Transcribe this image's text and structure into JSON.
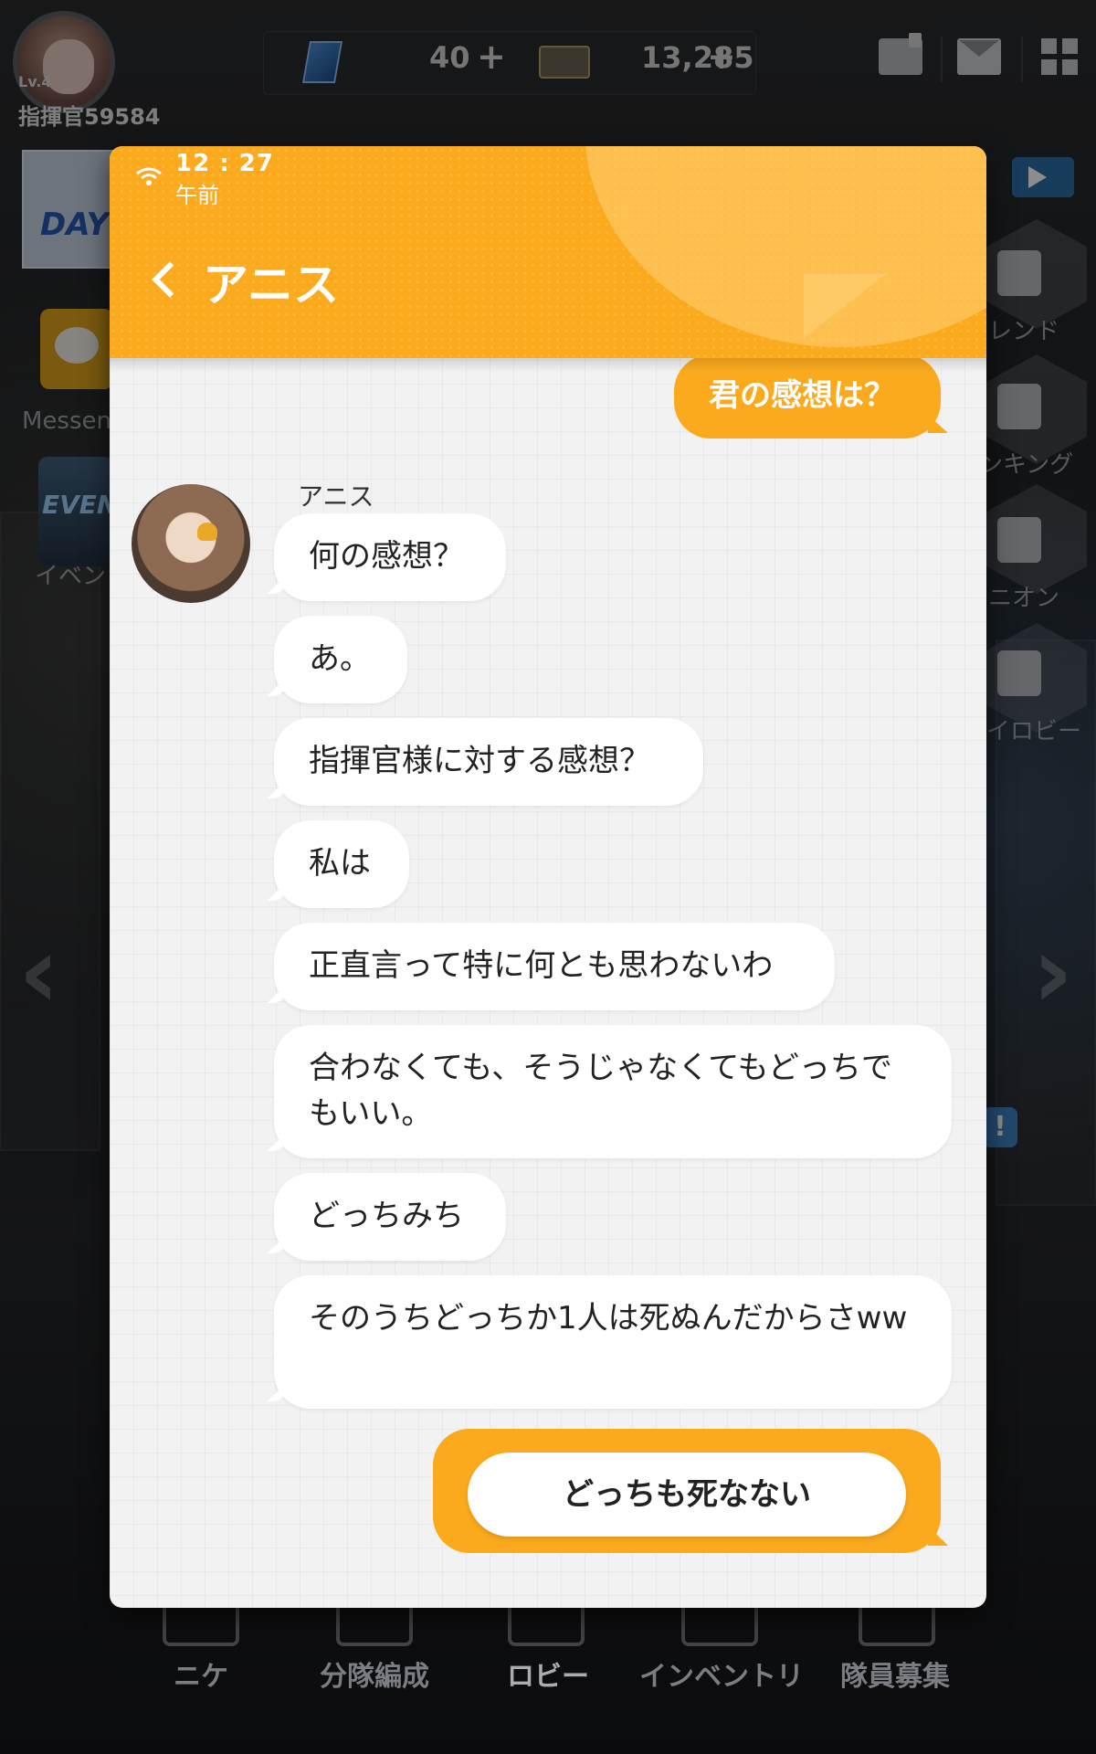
{
  "hud": {
    "level": "Lv.4",
    "player_name": "指揮官59584",
    "gems": "40",
    "credits": "13,285",
    "plus": "+"
  },
  "side": {
    "event_banner": "DAY",
    "messenger_label": "Messen",
    "event_label": "EVENT",
    "event_text": "イベン",
    "friend_label": "レンド",
    "ranking_label": "ンキング",
    "union_label": "ニオン",
    "lobby_label": "イロビー"
  },
  "bottom_nav": [
    "ニケ",
    "分隊編成",
    "ロビー",
    "インベントリ",
    "隊員募集"
  ],
  "messenger": {
    "time": "12 : 27",
    "ampm": "午前",
    "title": "アニス",
    "sender_name": "アニス",
    "outgoing_top": "君の感想は？",
    "messages": [
      "何の感想？",
      "あ。",
      "指揮官様に対する感想？",
      "私は",
      "正直言って特に何とも思わないわ",
      "合わなくても、そうじゃなくてもどっちでもいい。",
      "どっちみち",
      "そのうちどっちか1人は死ぬんだからさww"
    ],
    "reply_option": "どっちも死なない"
  },
  "colors": {
    "accent": "#fbaa1d",
    "chat_bg": "#f2f2f2",
    "bubble_in": "#ffffff"
  }
}
